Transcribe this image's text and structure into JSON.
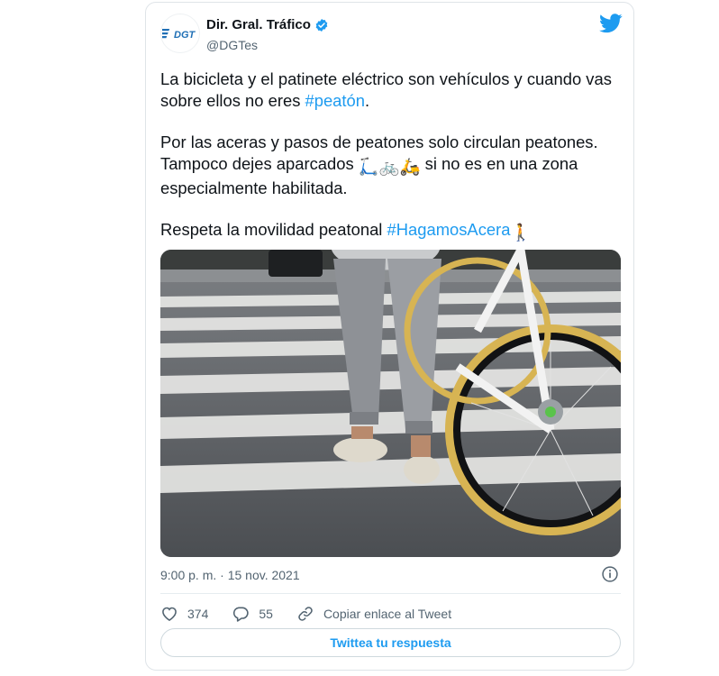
{
  "author": {
    "name": "Dir. Gral. Tráfico",
    "handle": "@DGTes",
    "logo_text": "DGT"
  },
  "tweet": {
    "line1_prefix": "La bicicleta y el patinete eléctrico son vehículos y cuando vas sobre ellos no eres ",
    "hashtag1": "#peatón",
    "line1_suffix": ".",
    "para2_part1": "Por las aceras y pasos de peatones solo circulan peatones. Tampoco dejes aparcados ",
    "emoji_vehicles": "🛴🚲🛵",
    "para2_part2": " si no es en una zona especialmente habilitada.",
    "para3_prefix": "Respeta la movilidad peatonal ",
    "hashtag2": "#HagamosAcera",
    "emoji_walker": "🚶"
  },
  "timestamp": "9:00 p. m. · 15 nov. 2021",
  "actions": {
    "likes": "374",
    "replies": "55",
    "copy_link": "Copiar enlace al Tweet"
  },
  "reply_button": "Twittea tu respuesta",
  "icons": [
    "verified-icon",
    "twitter-bird-icon",
    "info-icon",
    "heart-icon",
    "reply-icon",
    "link-icon"
  ],
  "colors": {
    "accent": "#1d9bf0",
    "text": "#0f1419",
    "muted": "#536471",
    "dgt_blue": "#1f6fb5"
  }
}
